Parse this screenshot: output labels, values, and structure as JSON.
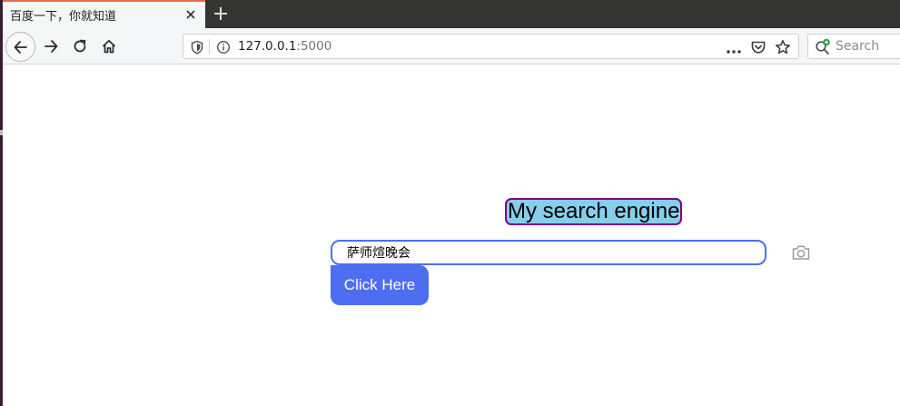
{
  "browser": {
    "tab": {
      "title": "百度一下，你就知道"
    },
    "url": {
      "host": "127.0.0.1",
      "port": ":5000"
    },
    "search": {
      "placeholder": "Search"
    }
  },
  "page": {
    "headline": "My search engine",
    "query": {
      "value": "萨师煊晚会"
    },
    "button_label": "Click Here"
  },
  "colors": {
    "accent": "#4e6ef2",
    "headline_bg": "#87ceeb",
    "headline_border": "#800080",
    "tab_highlight": "#e66b4d"
  },
  "icons": [
    "close-icon",
    "plus-icon",
    "back-arrow-icon",
    "forward-arrow-icon",
    "reload-icon",
    "home-icon",
    "shield-icon",
    "info-icon",
    "more-dots-icon",
    "pocket-icon",
    "star-icon",
    "search-icon",
    "camera-icon"
  ]
}
